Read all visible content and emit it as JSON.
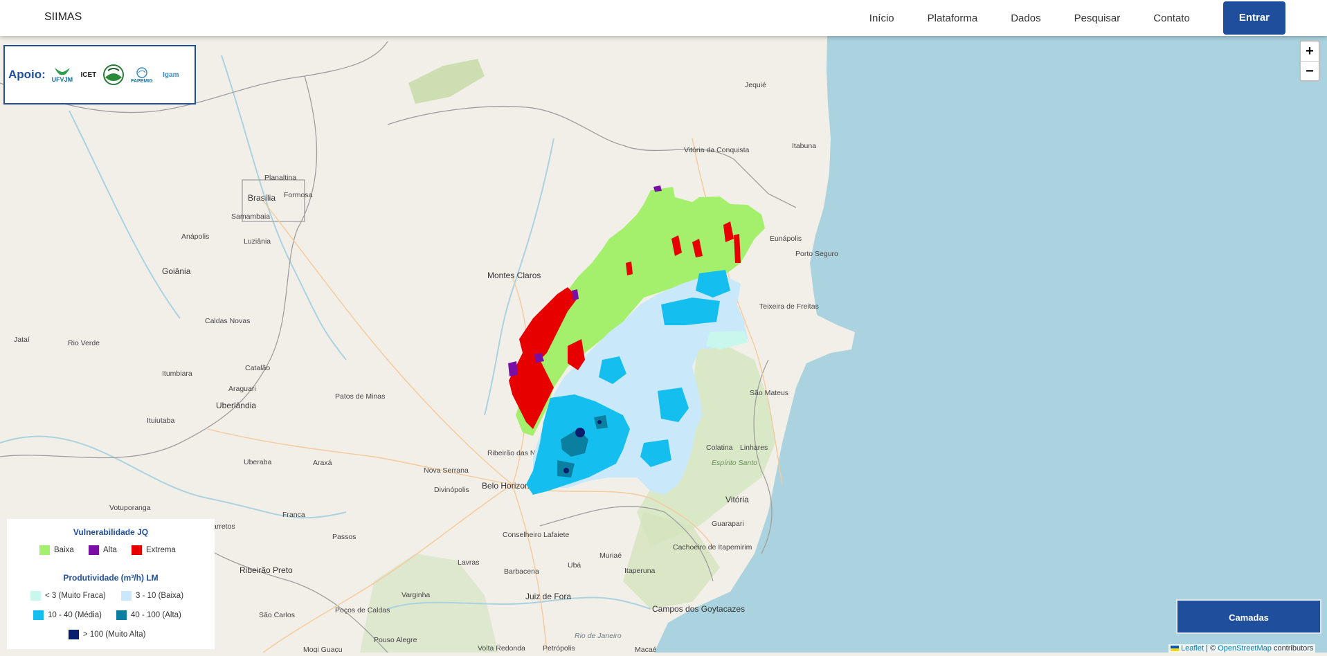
{
  "navbar": {
    "brand": "SIIMAS",
    "links": [
      "Início",
      "Plataforma",
      "Dados",
      "Pesquisar",
      "Contato"
    ],
    "cta": "Entrar"
  },
  "apoio": {
    "label": "Apoio:",
    "logos": [
      "UFVJM",
      "ICET",
      "FAPEMIG",
      "Igam"
    ]
  },
  "zoom": {
    "in": "+",
    "out": "−"
  },
  "legend": {
    "vuln_title": "Vulnerabilidade JQ",
    "vuln_items": [
      {
        "label": "Baixa",
        "color": "#a4f06c"
      },
      {
        "label": "Alta",
        "color": "#7a0fa6"
      },
      {
        "label": "Extrema",
        "color": "#e60000"
      }
    ],
    "prod_title": "Produtividade (m³/h) LM",
    "prod_items": [
      {
        "label": "< 3 (Muito Fraca)",
        "color": "#c8f7ee"
      },
      {
        "label": "3 - 10 (Baixa)",
        "color": "#c9e8fa"
      },
      {
        "label": "10 - 40 (Média)",
        "color": "#14bff0"
      },
      {
        "label": "40 - 100 (Alta)",
        "color": "#0a7fa0"
      },
      {
        "label": "> 100 (Muito Alta)",
        "color": "#0a1e6e"
      }
    ]
  },
  "camadas": "Camadas",
  "attribution": {
    "leaflet": "Leaflet",
    "sep": " | © ",
    "osm": "OpenStreetMap",
    "suffix": " contributors"
  },
  "cities": {
    "c1": "Brasília",
    "c2": "Planaltina",
    "c3": "Formosa",
    "c4": "Samambaia",
    "c5": "Anápolis",
    "c6": "Luziânia",
    "c7": "Goiânia",
    "c8": "Caldas Novas",
    "c9": "Jataí",
    "c10": "Rio Verde",
    "c11": "Catalão",
    "c12": "Itumbiara",
    "c13": "Araguari",
    "c14": "Uberlândia",
    "c15": "Ituiutaba",
    "c16": "Uberaba",
    "c17": "Araxá",
    "c18": "Patos de Minas",
    "c19": "Montes Claros",
    "c20": "Vitória da Conquista",
    "c21": "Itabuna",
    "c22": "Eunápolis",
    "c23": "Porto Seguro",
    "c24": "Teixeira de Freitas",
    "c25": "São Mateus",
    "c26": "Colatina",
    "c27": "Linhares",
    "c28": "Espírito Santo",
    "c29": "Vitória",
    "c30": "Guarapari",
    "c31": "Cachoeiro de Itapemirim",
    "c32": "Campos dos Goytacazes",
    "c33": "Belo Horizonte",
    "c34": "Ribeirão das Neves",
    "c35": "Nova Serrana",
    "c36": "Divinópolis",
    "c37": "Conselheiro Lafaiete",
    "c38": "Barbacena",
    "c39": "Juiz de Fora",
    "c40": "Ubá",
    "c41": "Muriaé",
    "c42": "Itaperuna",
    "c43": "Votuporanga",
    "c44": "Franca",
    "c45": "Passos",
    "c46": "Ribeirão Preto",
    "c47": "Varginha",
    "c48": "Lavras",
    "c49": "São Carlos",
    "c50": "Poços de Caldas",
    "c51": "Pouso Alegre",
    "c52": "Volta Redonda",
    "c53": "Petrópolis",
    "c54": "Macaé",
    "c55": "Rio de Janeiro",
    "c56": "Jequié",
    "c57": "Mogi Guaçu",
    "c58": "Barretos"
  }
}
